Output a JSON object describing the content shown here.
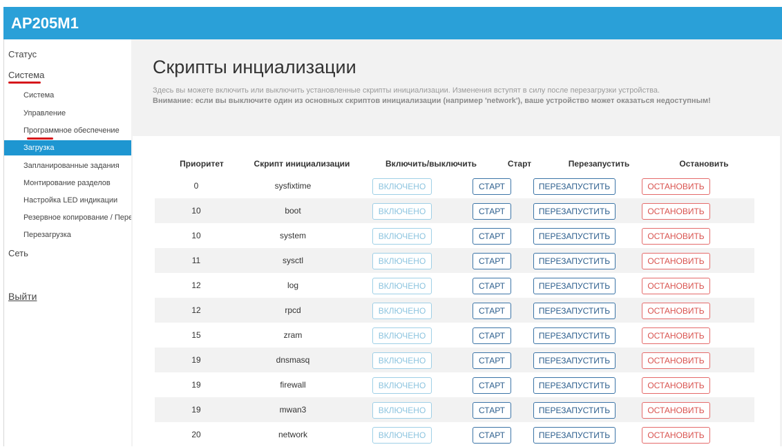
{
  "header": {
    "title": "AP205M1"
  },
  "sidebar": {
    "status": "Статус",
    "system": "Система",
    "subitems": [
      "Система",
      "Управление",
      "Программное обеспечение",
      "Загрузка",
      "Запланированные задания",
      "Монтирование разделов",
      "Настройка LED индикации",
      "Резервное копирование / Перепрошивка",
      "Перезагрузка"
    ],
    "network": "Сеть",
    "logout": "Выйти"
  },
  "main": {
    "title": "Скрипты инциализации",
    "description": "Здесь вы можете включить или выключить установленные скрипты инициализации. Изменения вступят в силу после перезагрузки устройства.",
    "warning": "Внимание: если вы выключите один из основных скриптов инициализации (например 'network'), ваше устройство может оказаться недоступным!"
  },
  "table": {
    "headers": {
      "priority": "Приоритет",
      "script": "Скрипт инициализации",
      "toggle": "Включить/выключить",
      "start": "Старт",
      "restart": "Перезапустить",
      "stop": "Остановить"
    },
    "buttons": {
      "enabled": "ВКЛЮЧЕНО",
      "start": "СТАРТ",
      "restart": "ПЕРЕЗАПУСТИТЬ",
      "stop": "ОСТАНОВИТЬ"
    },
    "rows": [
      {
        "priority": "0",
        "script": "sysfixtime"
      },
      {
        "priority": "10",
        "script": "boot"
      },
      {
        "priority": "10",
        "script": "system"
      },
      {
        "priority": "11",
        "script": "sysctl"
      },
      {
        "priority": "12",
        "script": "log"
      },
      {
        "priority": "12",
        "script": "rpcd"
      },
      {
        "priority": "15",
        "script": "zram"
      },
      {
        "priority": "19",
        "script": "dnsmasq"
      },
      {
        "priority": "19",
        "script": "firewall"
      },
      {
        "priority": "19",
        "script": "mwan3"
      },
      {
        "priority": "20",
        "script": "network"
      }
    ]
  },
  "colors": {
    "header_bg": "#2aa0d8",
    "active_item_bg": "#1e96d1",
    "underline_red": "#d6171b",
    "stop_red": "#d9534f",
    "start_blue": "#2d5f8e"
  }
}
